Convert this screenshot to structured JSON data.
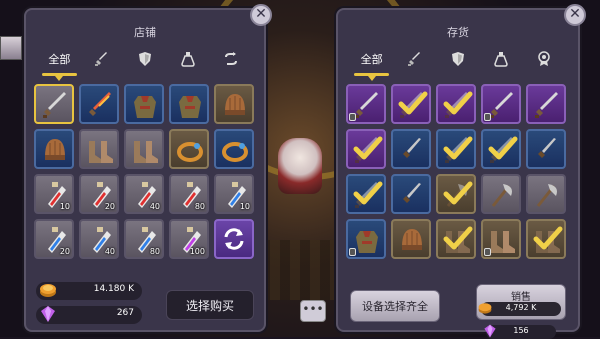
{
  "shop": {
    "title": "店铺",
    "tabs": [
      {
        "label": "全部",
        "icon": "all"
      },
      {
        "label": "",
        "icon": "sword-icon"
      },
      {
        "label": "",
        "icon": "shield-icon"
      },
      {
        "label": "",
        "icon": "potion-icon"
      },
      {
        "label": "",
        "icon": "refresh-arrow-icon"
      }
    ],
    "items": [
      {
        "type": "sword",
        "rarity": "grey",
        "count": ""
      },
      {
        "type": "fire-sword",
        "rarity": "blue",
        "count": ""
      },
      {
        "type": "armor",
        "rarity": "blue",
        "count": ""
      },
      {
        "type": "armor",
        "rarity": "blue",
        "count": ""
      },
      {
        "type": "helmet",
        "rarity": "brown",
        "count": ""
      },
      {
        "type": "helmet",
        "rarity": "blue",
        "count": ""
      },
      {
        "type": "boots",
        "rarity": "grey",
        "count": ""
      },
      {
        "type": "boots",
        "rarity": "grey",
        "count": ""
      },
      {
        "type": "ring",
        "rarity": "brown",
        "count": ""
      },
      {
        "type": "ring",
        "rarity": "blue",
        "count": ""
      },
      {
        "type": "potion-red",
        "rarity": "grey",
        "count": "10"
      },
      {
        "type": "potion-red",
        "rarity": "grey",
        "count": "20"
      },
      {
        "type": "potion-red",
        "rarity": "grey",
        "count": "40"
      },
      {
        "type": "potion-red",
        "rarity": "grey",
        "count": "80"
      },
      {
        "type": "potion-blue",
        "rarity": "grey",
        "count": "10"
      },
      {
        "type": "potion-blue",
        "rarity": "grey",
        "count": "20"
      },
      {
        "type": "potion-blue",
        "rarity": "grey",
        "count": "40"
      },
      {
        "type": "potion-blue",
        "rarity": "grey",
        "count": "80"
      },
      {
        "type": "potion-purple",
        "rarity": "grey",
        "count": "100"
      }
    ],
    "gold": "14.180 K",
    "gems": "267",
    "buy_label": "选择购买"
  },
  "inventory": {
    "title": "存货",
    "tabs": [
      {
        "label": "全部",
        "icon": "all"
      },
      {
        "label": "",
        "icon": "sword-icon"
      },
      {
        "label": "",
        "icon": "shield-icon"
      },
      {
        "label": "",
        "icon": "potion-icon"
      },
      {
        "label": "",
        "icon": "medal-icon"
      }
    ],
    "fill_label": "设备选择齐全",
    "sell_label": "销售",
    "sell_gold": "4,792 K",
    "sell_gems": "156"
  },
  "more_label": "•••",
  "colors": {
    "accent": "#e8c440",
    "panel": "#3a354a"
  }
}
